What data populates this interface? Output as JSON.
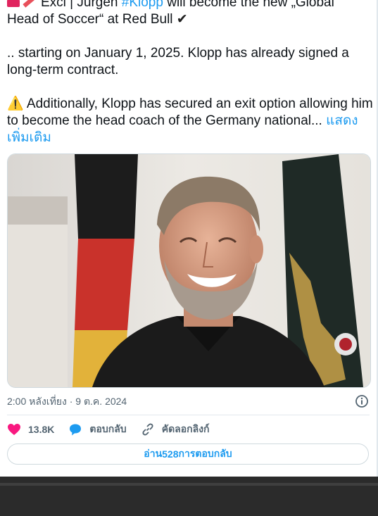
{
  "tweet": {
    "line1_prefix": "Excl | Jürgen ",
    "line1_hashtag": "#Klopp",
    "line1_suffix": " will become the new „Global",
    "line2": "Head of Soccer“ at Red Bull ",
    "check_mark": "✔",
    "paragraph2": ".. starting on January 1, 2025. Klopp has already signed a long-term contract.",
    "warning_emoji": "⚠️",
    "paragraph3": " Additionally, Klopp has secured an exit option allowing him to become the head coach of the Germany national... ",
    "show_more": "แสดงเพิ่มเติม"
  },
  "meta": {
    "timestamp": "2:00 หลังเที่ยง · 9 ต.ค. 2024"
  },
  "actions": {
    "like_count": "13.8K",
    "reply_label": "ตอบกลับ",
    "copy_link_label": "คัดลอกลิงก์"
  },
  "read_replies": {
    "prefix": "อ่าน ",
    "count": "528",
    "suffix": " การตอบกลับ"
  },
  "colors": {
    "link": "#1d9bf0",
    "heart": "#f91880",
    "reply_bubble": "#1d9bf0"
  }
}
